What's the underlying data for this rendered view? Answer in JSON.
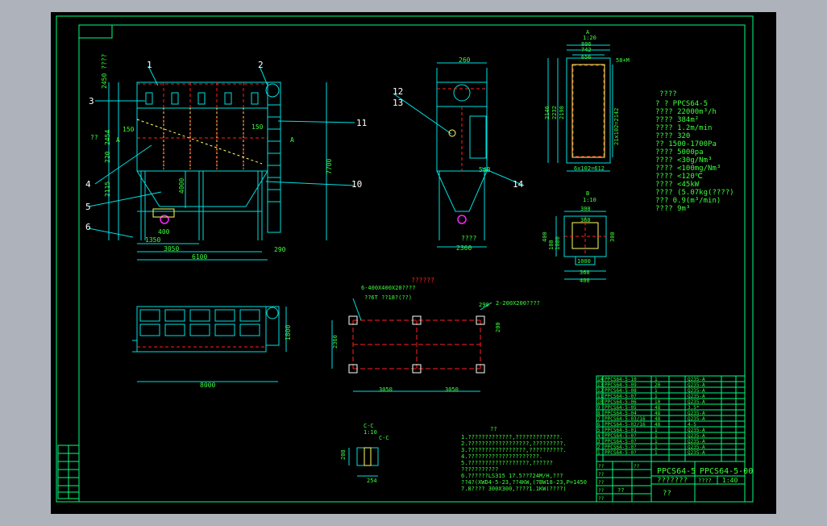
{
  "colors": {
    "background": "#000000",
    "frame": "#ffffff",
    "border": "#00ff7f",
    "cyan": "#00e0e0",
    "green": "#3cff3c",
    "red": "#ff2020",
    "yellow": "#ffff60",
    "magenta": "#ff20ff",
    "white": "#ffffff",
    "title_block": "#00ff7f"
  },
  "front_view": {
    "callouts": [
      "1",
      "2",
      "3",
      "11",
      "4",
      "10",
      "5",
      "6"
    ],
    "dims": {
      "h1": "2450 ????",
      "h2": "2454",
      "h3": "220",
      "h4": "2115",
      "d150a": "150",
      "d150b": "150",
      "d1350": "1350",
      "d400": "400",
      "d3050": "3050",
      "d6100": "6100",
      "d290": "290",
      "d7700": "7700",
      "d4000": "4000",
      "sec_a1": "A",
      "sec_a2": "A",
      "sec_a3": "A",
      "q": "??"
    }
  },
  "side_view": {
    "callouts": [
      "12",
      "13",
      "14"
    ],
    "dims": {
      "w260": "260",
      "d2360": "2360",
      "note": "????",
      "d48": "548"
    }
  },
  "detail_a": {
    "label": "A",
    "scale": "1:20",
    "dims": [
      "806",
      "742",
      "656",
      "2146",
      "2232",
      "2198",
      "21x102=2142",
      "6x102=612",
      "58+M"
    ]
  },
  "detail_b": {
    "label": "B",
    "scale": "1:10",
    "dims": [
      "300",
      "360",
      "400",
      "300",
      "100",
      "1000",
      "1000",
      "360",
      "400"
    ]
  },
  "specs": {
    "title": "????",
    "rows": [
      "? ?  PPCS64-5",
      "????  22000m³/h",
      "????  384m²",
      "????  1.2m/min",
      "????  320",
      "??    1500-1700Pa",
      "????  5000pa",
      "????  <30g/Nm³",
      "????  <100mg/Nm³",
      "????  <120℃",
      "????  <45kW",
      "????  (5.07kg(????)",
      "???   0.9(m³/min)",
      "????  9m³"
    ]
  },
  "plan_view": {
    "dims": {
      "d8000": "8000",
      "d1800": "1800"
    }
  },
  "foundation": {
    "note1": "6-400X400X20????",
    "note2": "??6T ??18?(??)",
    "note3": "2-200X200????",
    "dims": [
      "290",
      "2360",
      "3050",
      "3050",
      "200"
    ]
  },
  "section_cc": {
    "label": "C-C",
    "scale": "1:10",
    "dims": [
      "254",
      "208",
      "C-C"
    ]
  },
  "tech_notes": {
    "title": "??",
    "lines": [
      "1.?????????????,?????????????.",
      "2.??????????????????,?????????.",
      "3.?????????????????,??????????.",
      "4.?????????????????????.",
      "5.??????????????????,??????",
      "  ???????????",
      "6.??????LS315 17.5??724M/H,???",
      "  ??4?(XWD4-5-23,??4KW,(7BW18-23,P=1450",
      "7.8???? 300X300,????1.1KW(????)"
    ]
  },
  "bom": {
    "rows": [
      [
        "14",
        "PPCS64-5-10",
        "1",
        "Q235-A"
      ],
      [
        "13",
        "PPCS64-5-09",
        "20",
        "Q235-A"
      ],
      [
        "12",
        "PPCS64-5-08",
        "1",
        "Q235-A"
      ],
      [
        "11",
        "PPCS64-5-07",
        "1",
        "Q235-A"
      ],
      [
        "10",
        "PPCS64-5-06",
        "10",
        "Q235-A"
      ],
      [
        "9",
        "PPCS64-5-05",
        "48",
        "3.5*"
      ],
      [
        "8",
        "PPCS64-5-04",
        "48",
        "Q235-A"
      ],
      [
        "7",
        "PPCS64-5-03/16",
        "48",
        "Q235-A"
      ],
      [
        "6",
        "PPCS64-5-02/16",
        "48",
        "4-5"
      ],
      [
        "5",
        "PPCS64-5-01",
        "1",
        "Q235-A"
      ],
      [
        "4",
        "PPCS64-5-0?",
        "1",
        "Q235-A"
      ],
      [
        "3",
        "PPCS64-5-0?",
        "1",
        "Q235-A"
      ],
      [
        "2",
        "PPCS64-5-0?",
        "1",
        "Q235-A"
      ],
      [
        "1",
        "PPCS64-5-0?",
        "1",
        "Q235-A"
      ]
    ]
  },
  "title_block": {
    "drawing_no": "PPCS64-5",
    "drawing_no2": "PPCS64-5-00",
    "name": "???????",
    "scale": "1:40",
    "sheet": "??",
    "dept": "????",
    "weight": "??",
    "labels": [
      "??",
      "??",
      "??",
      "??",
      "??",
      "??"
    ]
  }
}
